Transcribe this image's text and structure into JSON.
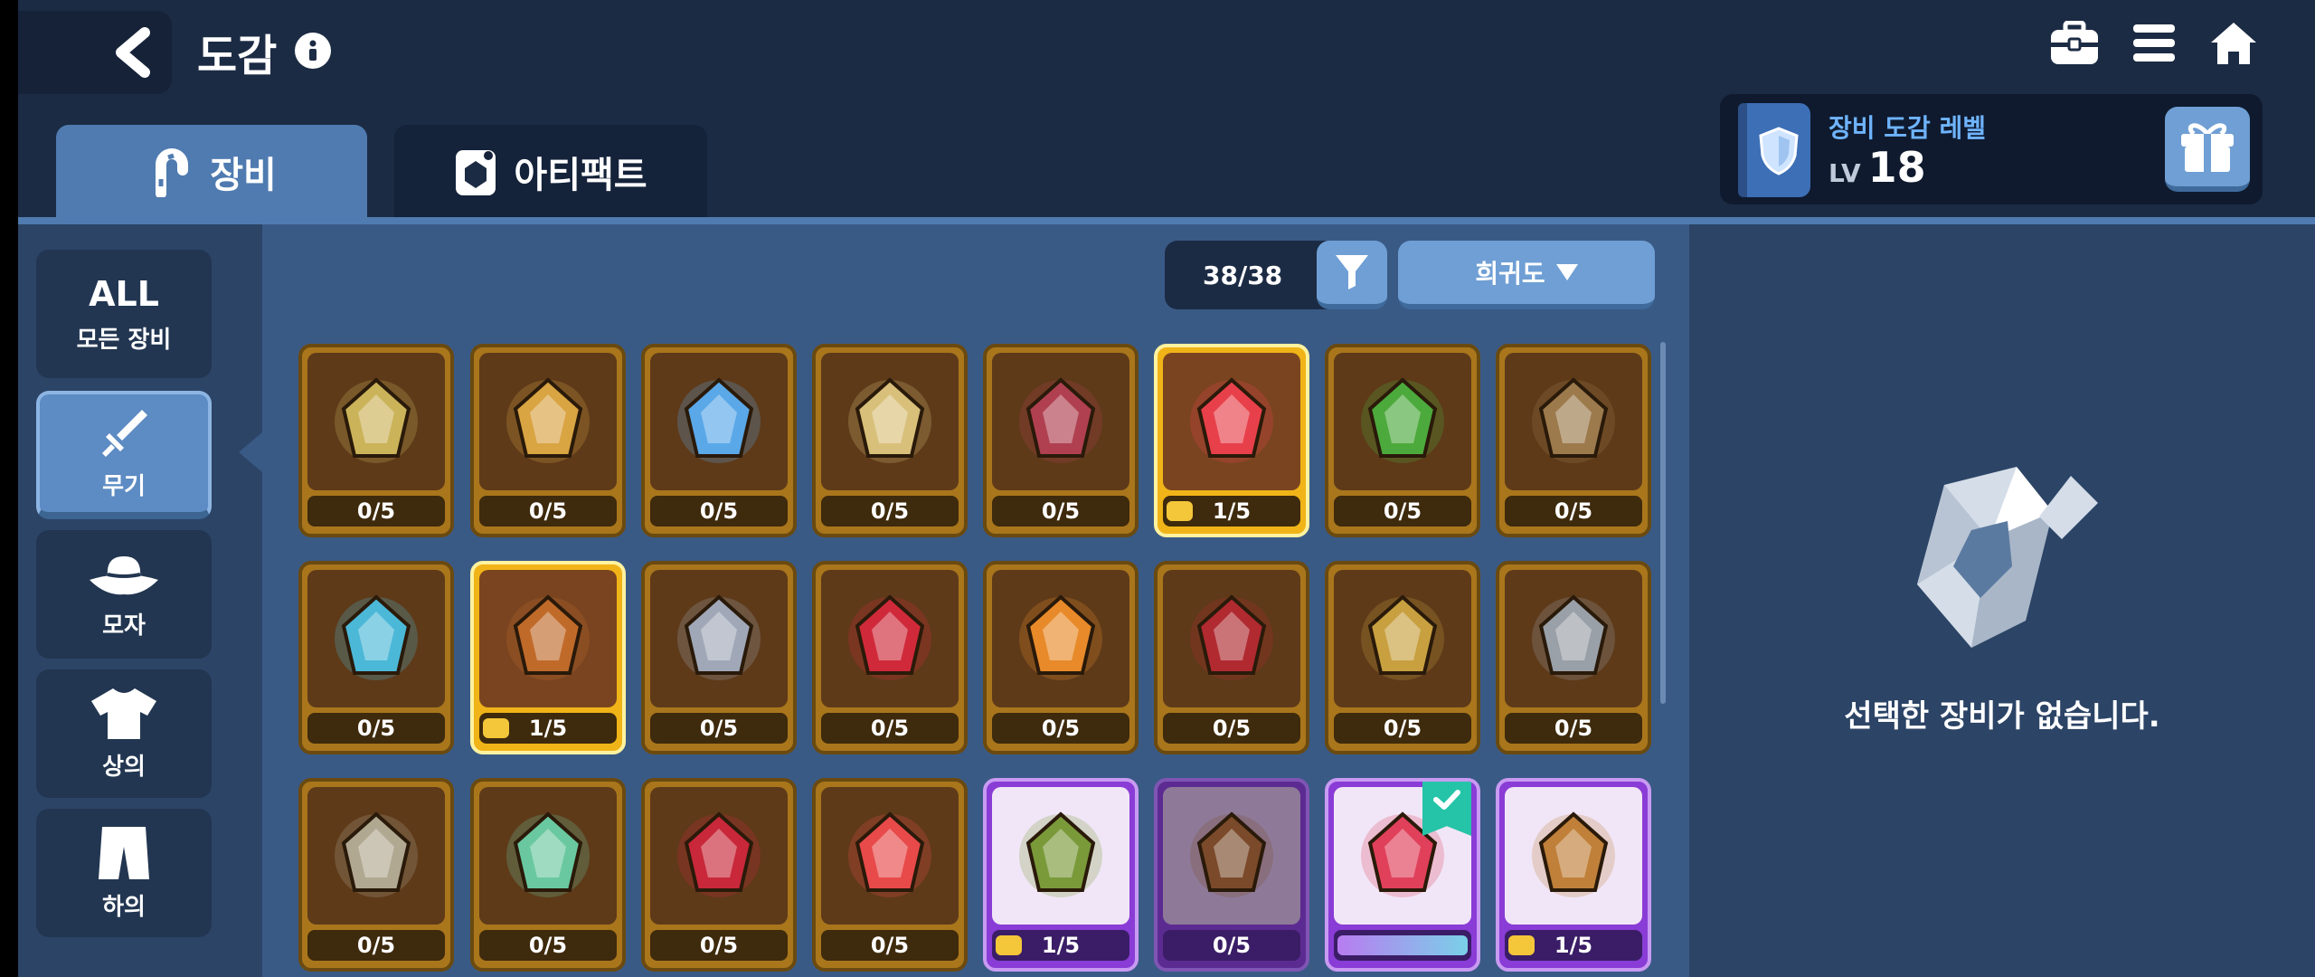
{
  "header": {
    "title": "도감"
  },
  "tabs": [
    {
      "label": "장비"
    },
    {
      "label": "아티팩트"
    }
  ],
  "collection_level": {
    "label": "장비 도감 레벨",
    "lv_prefix": "LV",
    "value": "18"
  },
  "sidebar": {
    "items": [
      {
        "top": "ALL",
        "label": "모든 장비"
      },
      {
        "label": "무기"
      },
      {
        "label": "모자"
      },
      {
        "label": "상의"
      },
      {
        "label": "하의"
      }
    ]
  },
  "toolbar": {
    "count": "38/38",
    "sort_label": "희귀도"
  },
  "grid": {
    "items": [
      {
        "count": "0/5",
        "progress": 0,
        "rarity": "brown",
        "icon": "spiked-amulet-icon",
        "color": "#cbb35a"
      },
      {
        "count": "0/5",
        "progress": 0,
        "rarity": "brown",
        "icon": "golden-staff-icon",
        "color": "#d9a442"
      },
      {
        "count": "0/5",
        "progress": 0,
        "rarity": "brown",
        "icon": "ice-crystal-icon",
        "color": "#5aa8e8"
      },
      {
        "count": "0/5",
        "progress": 0,
        "rarity": "brown",
        "icon": "paper-blade-icon",
        "color": "#d9c07a"
      },
      {
        "count": "0/5",
        "progress": 0,
        "rarity": "brown",
        "icon": "dark-dagger-icon",
        "color": "#b04050"
      },
      {
        "count": "1/5",
        "progress": 0.2,
        "rarity": "gold",
        "icon": "candy-hammer-icon",
        "color": "#e8404a"
      },
      {
        "count": "0/5",
        "progress": 0,
        "rarity": "brown",
        "icon": "poison-flask-icon",
        "color": "#4caa3c"
      },
      {
        "count": "0/5",
        "progress": 0,
        "rarity": "brown",
        "icon": "wooden-shield-icon",
        "color": "#9c7a4c"
      },
      {
        "count": "0/5",
        "progress": 0,
        "rarity": "brown",
        "icon": "candy-bomb-icon",
        "color": "#4cb8d8"
      },
      {
        "count": "1/5",
        "progress": 0.2,
        "rarity": "gold",
        "icon": "dumbbell-icon",
        "color": "#c06a2a"
      },
      {
        "count": "0/5",
        "progress": 0,
        "rarity": "brown",
        "icon": "shuriken-icon",
        "color": "#a0a8b8"
      },
      {
        "count": "0/5",
        "progress": 0,
        "rarity": "brown",
        "icon": "red-guitar-icon",
        "color": "#d02a3a"
      },
      {
        "count": "0/5",
        "progress": 0,
        "rarity": "brown",
        "icon": "fire-gem-icon",
        "color": "#e88a2a"
      },
      {
        "count": "0/5",
        "progress": 0,
        "rarity": "brown",
        "icon": "bat-wing-icon",
        "color": "#b02a30"
      },
      {
        "count": "0/5",
        "progress": 0,
        "rarity": "brown",
        "icon": "golden-horn-icon",
        "color": "#c8a040"
      },
      {
        "count": "0/5",
        "progress": 0,
        "rarity": "brown",
        "icon": "stone-claw-icon",
        "color": "#9aa0a8"
      },
      {
        "count": "0/5",
        "progress": 0,
        "rarity": "brown",
        "icon": "gear-wrench-icon",
        "color": "#b0a890"
      },
      {
        "count": "0/5",
        "progress": 0,
        "rarity": "brown",
        "icon": "star-wand-icon",
        "color": "#6ac8a0"
      },
      {
        "count": "0/5",
        "progress": 0,
        "rarity": "brown",
        "icon": "red-apple-icon",
        "color": "#c8283a"
      },
      {
        "count": "0/5",
        "progress": 0,
        "rarity": "brown",
        "icon": "candy-cane-icon",
        "color": "#e84a4a"
      },
      {
        "count": "1/5",
        "progress": 0.2,
        "rarity": "purple",
        "icon": "leaf-bow-icon",
        "color": "#7a9a3a"
      },
      {
        "count": "0/5",
        "progress": 0,
        "rarity": "purple-dark",
        "icon": "wooden-flute-icon",
        "color": "#7a4a2a"
      },
      {
        "count": "",
        "progress": 1,
        "rarity": "purple",
        "icon": "christmas-stocking-icon",
        "color": "#e0405a",
        "checked": true
      },
      {
        "count": "1/5",
        "progress": 0.2,
        "rarity": "purple",
        "icon": "wooden-hammer-icon",
        "color": "#c0803a"
      }
    ]
  },
  "detail": {
    "empty_text": "선택한 장비가 없습니다."
  }
}
